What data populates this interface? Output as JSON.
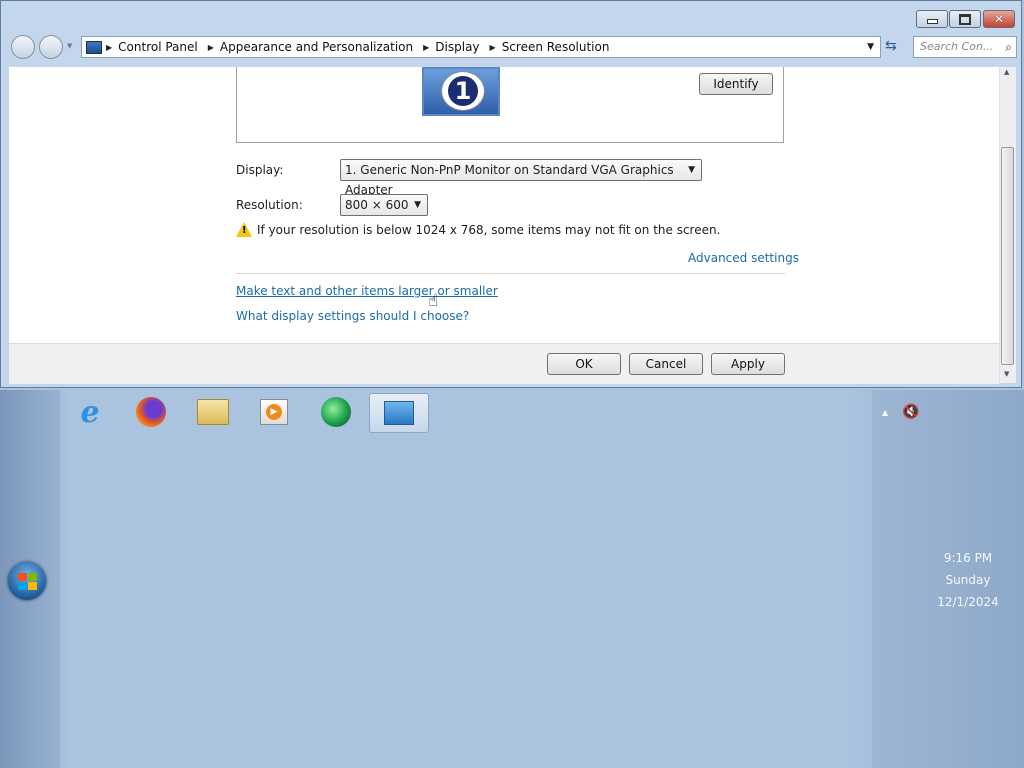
{
  "window": {
    "breadcrumb": [
      "Control Panel",
      "Appearance and Personalization",
      "Display",
      "Screen Resolution"
    ],
    "search_placeholder": "Search Con...",
    "monitor_number": "1",
    "identify_label": "Identify",
    "display_label": "Display:",
    "display_value": "1. Generic Non-PnP Monitor on Standard VGA Graphics Adapter",
    "resolution_label": "Resolution:",
    "resolution_value": "800 × 600",
    "warning_text": "If your resolution is below 1024 x 768, some items may not fit on the screen.",
    "advanced_link": "Advanced settings",
    "text_size_link": "Make text and other items larger or smaller",
    "settings_help_link": "What display settings should I choose?",
    "ok_label": "OK",
    "cancel_label": "Cancel",
    "apply_label": "Apply"
  },
  "taskbar": {
    "pinned": [
      "internet-explorer-icon",
      "firefox-icon",
      "file-explorer-icon",
      "media-player-icon",
      "media-center-icon",
      "display-settings-icon"
    ],
    "clock": {
      "time": "9:16 PM",
      "day": "Sunday",
      "date": "12/1/2024"
    }
  },
  "colors": {
    "link": "#1a6ba9",
    "desktop": "#aac3df",
    "window_frame": "#c3d6ec"
  }
}
